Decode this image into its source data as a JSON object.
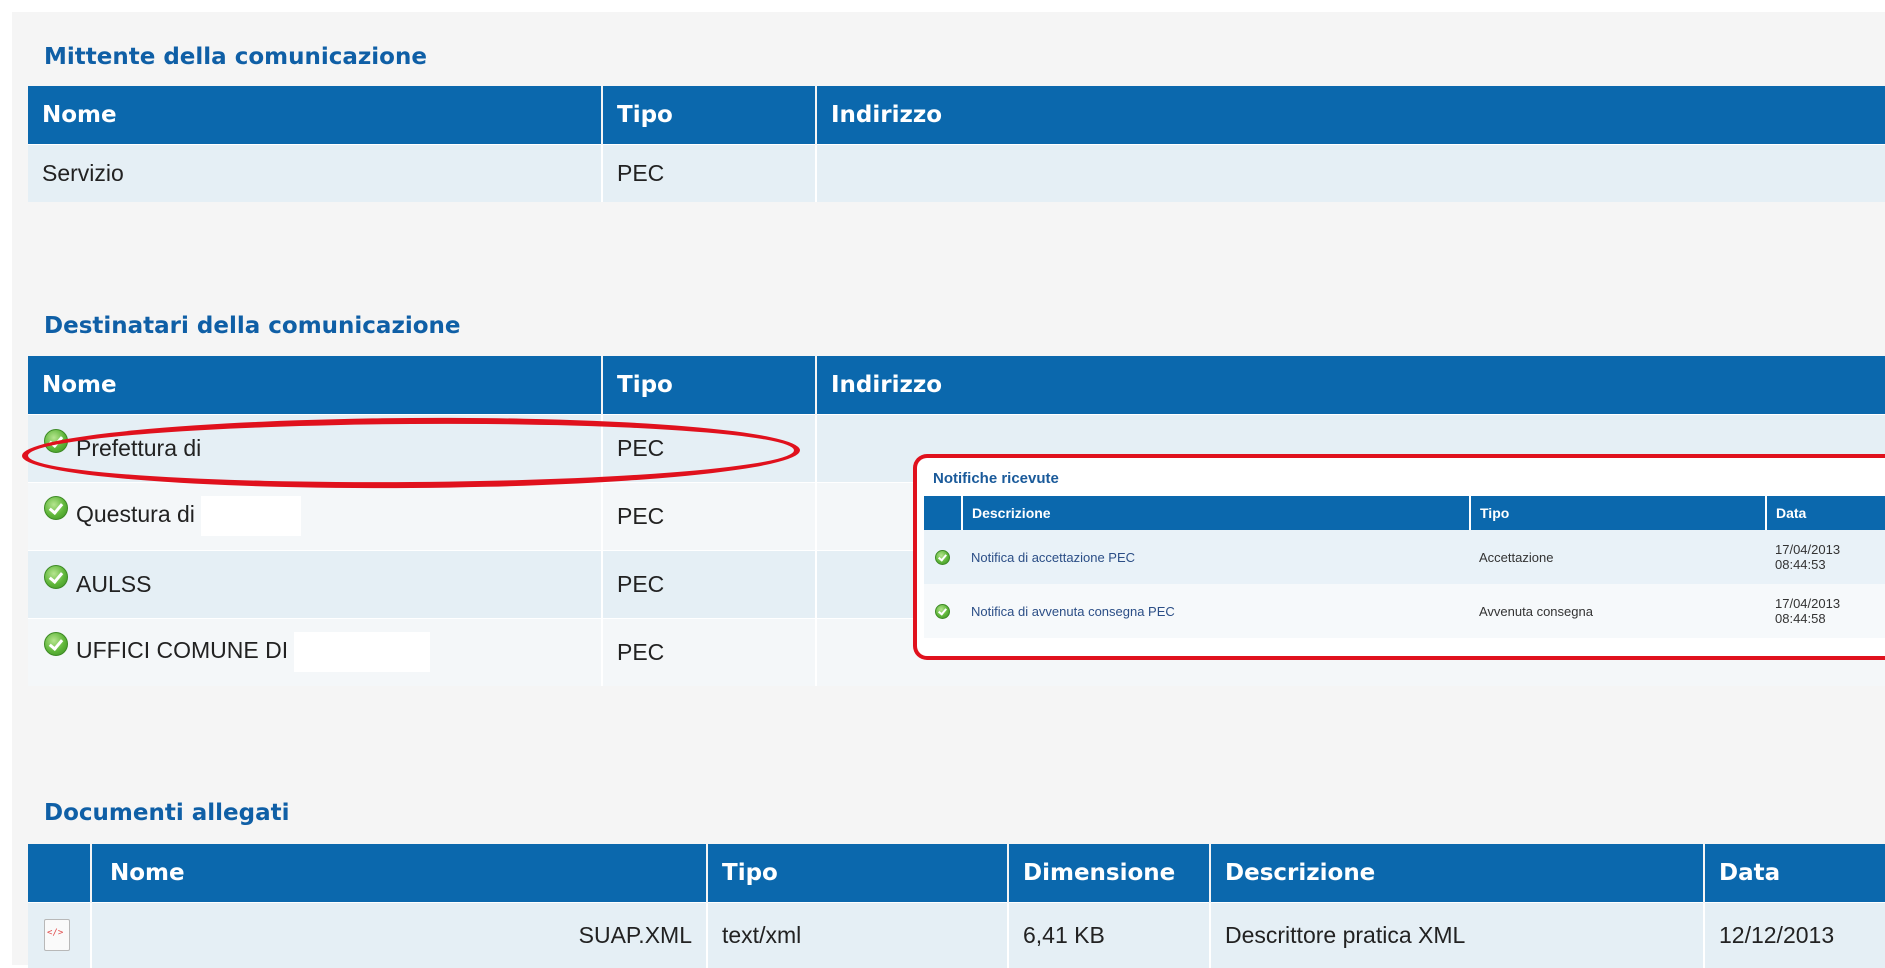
{
  "mittente": {
    "title": "Mittente della comunicazione",
    "columns": [
      "Nome",
      "Tipo",
      "Indirizzo"
    ],
    "rows": [
      {
        "nome": "Servizio",
        "tipo": "PEC",
        "indirizzo": ""
      }
    ]
  },
  "destinatari": {
    "title": "Destinatari della comunicazione",
    "columns": [
      "Nome",
      "Tipo",
      "Indirizzo"
    ],
    "rows": [
      {
        "nome": "Prefettura di",
        "tipo": "PEC",
        "icon": "check-circle-icon"
      },
      {
        "nome": "Questura di",
        "tipo": "PEC",
        "icon": "check-circle-icon"
      },
      {
        "nome": "AULSS",
        "tipo": "PEC",
        "icon": "check-circle-icon"
      },
      {
        "nome": "UFFICI COMUNE DI",
        "tipo": "PEC",
        "icon": "check-circle-icon"
      }
    ]
  },
  "notifiche": {
    "title": "Notifiche ricevute",
    "columns": [
      "",
      "Descrizione",
      "Tipo",
      "Data"
    ],
    "rows": [
      {
        "descrizione": "Notifica di accettazione PEC",
        "tipo": "Accettazione",
        "data_date": "17/04/2013",
        "data_time": "08:44:53"
      },
      {
        "descrizione": "Notifica di avvenuta consegna PEC",
        "tipo": "Avvenuta consegna",
        "data_date": "17/04/2013",
        "data_time": "08:44:58"
      }
    ]
  },
  "documenti": {
    "title": "Documenti allegati",
    "columns": [
      "",
      "Nome",
      "Tipo",
      "Dimensione",
      "Descrizione",
      "Data"
    ],
    "rows": [
      {
        "icon": "xml-file-icon",
        "nome": "SUAP.XML",
        "tipo": "text/xml",
        "dimensione": "6,41 KB",
        "descrizione": "Descrittore pratica XML",
        "data": "12/12/2013"
      }
    ]
  },
  "colors": {
    "header_blue": "#0b68ad",
    "title_blue": "#0f5fa6",
    "annotation_red": "#e0111d",
    "status_ok": "#5fb63a"
  }
}
